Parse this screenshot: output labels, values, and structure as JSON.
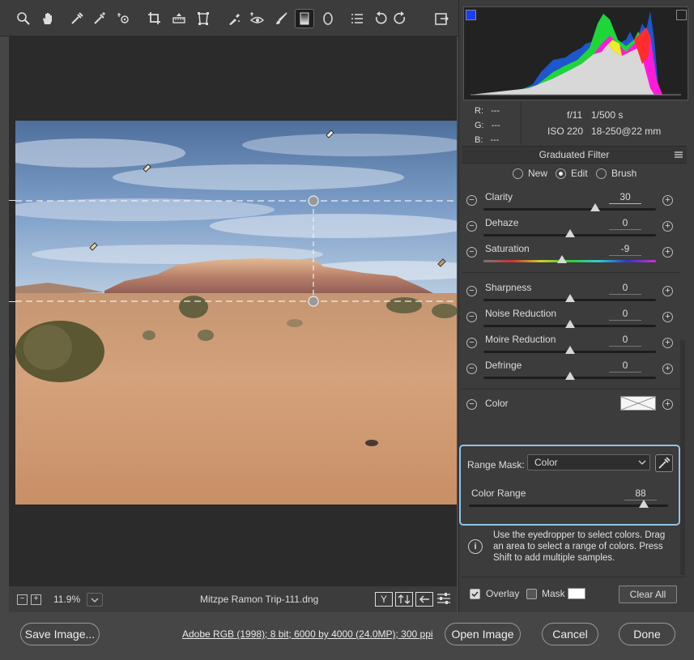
{
  "toolbar": {
    "tools": [
      "zoom-icon",
      "hand-icon",
      "white-balance-icon",
      "color-sampler-icon",
      "targeted-adjustment-icon",
      "crop-icon",
      "straighten-icon",
      "transform-icon",
      "spot-removal-icon",
      "red-eye-icon",
      "adjustment-brush-icon",
      "graduated-filter-icon",
      "radial-filter-icon",
      "preferences-icon",
      "rotate-left-icon",
      "rotate-right-icon"
    ],
    "fullscreen_icon": "fullscreen-icon"
  },
  "status": {
    "zoom": "11.9%",
    "filename": "Mitzpe Ramon Trip-111.dng"
  },
  "readout": {
    "r_label": "R:",
    "r_val": "---",
    "g_label": "G:",
    "g_val": "---",
    "b_label": "B:",
    "b_val": "---",
    "aperture": "f/11",
    "shutter": "1/500 s",
    "iso": "ISO 220",
    "lens": "18-250@22 mm"
  },
  "filter": {
    "title": "Graduated Filter",
    "modes": [
      {
        "label": "New",
        "selected": false
      },
      {
        "label": "Edit",
        "selected": true
      },
      {
        "label": "Brush",
        "selected": false
      }
    ]
  },
  "sliders": [
    {
      "label": "Clarity",
      "value": "30",
      "pos": 0.65
    },
    {
      "label": "Dehaze",
      "value": "0",
      "pos": 0.5
    },
    {
      "label": "Saturation",
      "value": "-9",
      "pos": 0.455
    },
    {
      "label": "Sharpness",
      "value": "0",
      "pos": 0.5
    },
    {
      "label": "Noise Reduction",
      "value": "0",
      "pos": 0.5
    },
    {
      "label": "Moire Reduction",
      "value": "0",
      "pos": 0.5
    },
    {
      "label": "Defringe",
      "value": "0",
      "pos": 0.5
    }
  ],
  "color": {
    "label": "Color"
  },
  "range_mask": {
    "label": "Range Mask:",
    "selected": "Color",
    "color_range_label": "Color Range",
    "color_range_value": "88",
    "color_range_pos": 0.88
  },
  "info": {
    "text": "Use the eyedropper to select colors. Drag an area to select a range of colors. Press Shift to add multiple samples."
  },
  "overlay": {
    "label": "Overlay",
    "checked": true
  },
  "mask": {
    "label": "Mask",
    "checked": false
  },
  "clear_all": "Clear All",
  "footer": {
    "save": "Save Image...",
    "workflow": "Adobe RGB (1998); 8 bit; 6000 by 4000 (24.0MP); 300 ppi",
    "open": "Open Image",
    "cancel": "Cancel",
    "done": "Done"
  },
  "colors": {
    "accent": "#8fc3e8",
    "panel": "#3c3c3c",
    "background": "#464646"
  }
}
